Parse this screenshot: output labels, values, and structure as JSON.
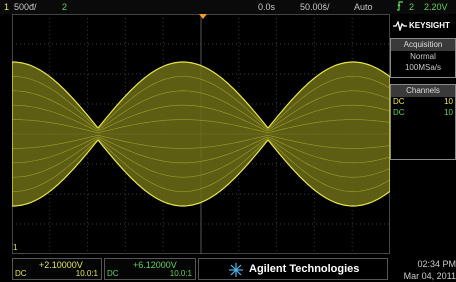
{
  "top": {
    "ch1_num": "1",
    "ch1_scale": "500đ/",
    "ch2_num": "2",
    "time_offset": "0.0s",
    "time_scale": "50.00š/",
    "trigger_mode": "Auto",
    "trigger_icon": "trigger-edge-icon",
    "trigger_ch": "2",
    "trigger_level": "2.20V"
  },
  "panel": {
    "brand": "KEYSIGHT",
    "acquisition_title": "Acquisition",
    "acquisition_mode": "Normal",
    "sample_rate": "100MSa/s",
    "channels_title": "Channels",
    "channels": [
      {
        "coupling": "DC",
        "probe": "10"
      },
      {
        "coupling": "DC",
        "probe": "10"
      }
    ]
  },
  "bottom": {
    "ch1": {
      "offset": "+2.10000V",
      "coupling": "DC",
      "probe": "10.0:1"
    },
    "ch2": {
      "offset": "+6.12000V",
      "coupling": "DC",
      "probe": "10.0:1"
    },
    "company": "Agilent Technologies",
    "time": "02:34 PM",
    "date": "Mar 04, 2011"
  },
  "colors": {
    "ch1": "#e8e84a",
    "ch2": "#5fd35f",
    "grid": "#3c3c3c"
  },
  "markers": {
    "ground": "1",
    "trigger_pointer": "triangle-down-icon"
  }
}
